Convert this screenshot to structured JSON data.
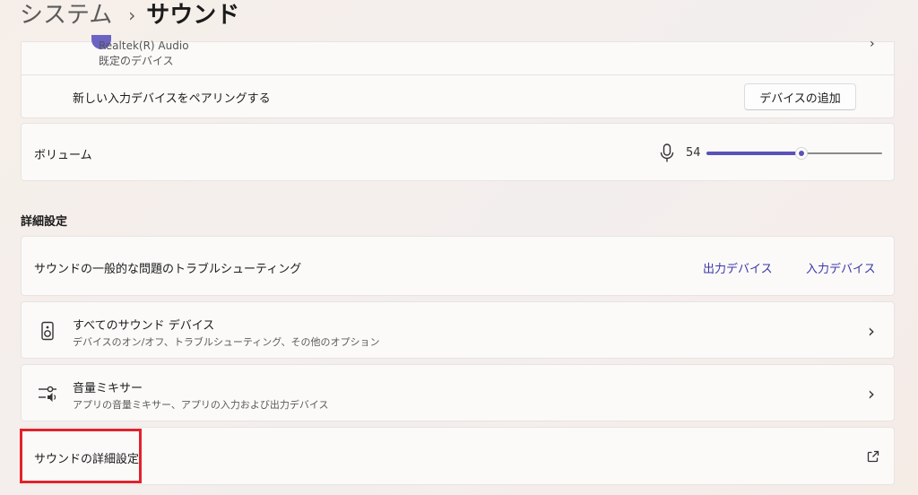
{
  "breadcrumb": {
    "parent": "システム",
    "separator": "›",
    "current": "サウンド"
  },
  "input_device": {
    "name": "Realtek(R) Audio",
    "subtitle": "既定のデバイス"
  },
  "pair_row": {
    "label": "新しい入力デバイスをペアリングする",
    "button": "デバイスの追加"
  },
  "volume": {
    "label": "ボリューム",
    "value": "54",
    "level_percent": 54
  },
  "advanced": {
    "title": "詳細設定",
    "troubleshoot": {
      "label": "サウンドの一般的な問題のトラブルシューティング",
      "output_link": "出力デバイス",
      "input_link": "入力デバイス"
    },
    "all_devices": {
      "title": "すべてのサウンド デバイス",
      "subtitle": "デバイスのオン/オフ、トラブルシューティング、その他のオプション"
    },
    "mixer": {
      "title": "音量ミキサー",
      "subtitle": "アプリの音量ミキサー、アプリの入力および出力デバイス"
    },
    "more_settings": {
      "label": "サウンドの詳細設定"
    }
  },
  "icons": {
    "chevron": "chevron-right-icon",
    "mic": "microphone-icon",
    "speaker": "speaker-icon",
    "mixer": "mixer-icon",
    "external": "open-external-icon"
  },
  "colors": {
    "accent": "#5a52b8",
    "link": "#3a37a6",
    "highlight": "#e0232b"
  }
}
